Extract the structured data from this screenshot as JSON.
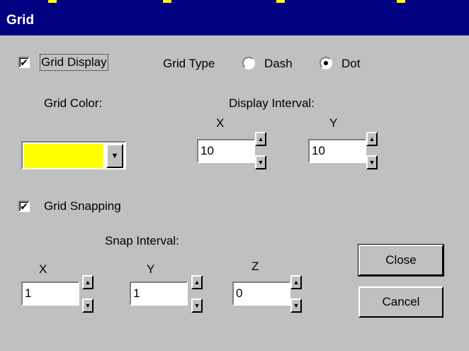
{
  "window": {
    "title": "Grid"
  },
  "grid_display": {
    "label": "Grid Display",
    "checked": true
  },
  "grid_type": {
    "label": "Grid Type",
    "options": [
      "Dash",
      "Dot"
    ],
    "selected": "Dot"
  },
  "grid_color": {
    "label": "Grid Color:",
    "value_color": "#ffff00"
  },
  "display_interval": {
    "label": "Display Interval:",
    "x": {
      "label": "X",
      "value": "10"
    },
    "y": {
      "label": "Y",
      "value": "10"
    }
  },
  "grid_snapping": {
    "label": "Grid Snapping",
    "checked": true
  },
  "snap_interval": {
    "label": "Snap Interval:",
    "x": {
      "label": "X",
      "value": "1"
    },
    "y": {
      "label": "Y",
      "value": "1"
    },
    "z": {
      "label": "Z",
      "value": "0"
    }
  },
  "buttons": {
    "close": "Close",
    "cancel": "Cancel"
  },
  "colors": {
    "titlebar": "#000080",
    "face": "#c0c0c0",
    "highlight_yellow": "#ffff00"
  }
}
